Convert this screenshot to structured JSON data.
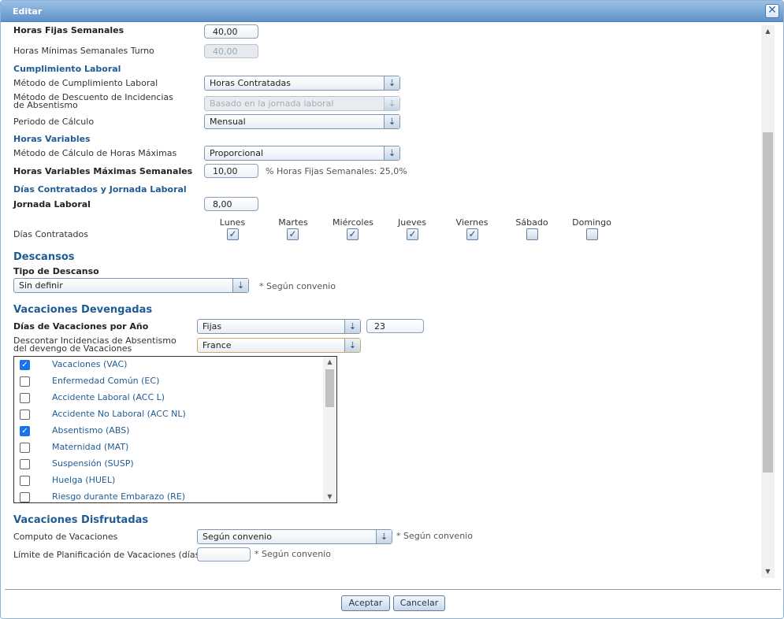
{
  "dialog": {
    "title": "Editar",
    "close_label": "✕"
  },
  "horas_fijas": {
    "label": "Horas Fijas Semanales",
    "value": "40,00"
  },
  "horas_minimas": {
    "label": "Horas Mínimas Semanales Turno",
    "value": "40,00"
  },
  "cumplimiento": {
    "section": "Cumplimiento Laboral",
    "metodo": {
      "label": "Método de Cumplimiento Laboral",
      "value": "Horas Contratadas"
    },
    "descuento": {
      "label": "Método de Descuento de Incidencias de Absentismo",
      "value": "Basado en la jornada laboral"
    },
    "periodo": {
      "label": "Periodo de Cálculo",
      "value": "Mensual"
    }
  },
  "horas_variables": {
    "section": "Horas Variables",
    "metodo": {
      "label": "Método de Cálculo de Horas Máximas",
      "value": "Proporcional"
    },
    "maximas": {
      "label": "Horas Variables Máximas Semanales",
      "value": "10,00",
      "note": "% Horas Fijas Semanales: 25,0%"
    }
  },
  "dias_contratados": {
    "section": "Días Contratados y Jornada Laboral",
    "jornada": {
      "label": "Jornada Laboral",
      "value": "8,00"
    },
    "label": "Días Contratados",
    "days": [
      {
        "name": "Lunes",
        "checked": true
      },
      {
        "name": "Martes",
        "checked": true
      },
      {
        "name": "Miércoles",
        "checked": true
      },
      {
        "name": "Jueves",
        "checked": true
      },
      {
        "name": "Viernes",
        "checked": true
      },
      {
        "name": "Sábado",
        "checked": false
      },
      {
        "name": "Domingo",
        "checked": false
      }
    ]
  },
  "descansos": {
    "section": "Descansos",
    "tipo": {
      "label": "Tipo de Descanso",
      "value": "Sin definir",
      "note": "* Según convenio"
    }
  },
  "vacaciones_devengadas": {
    "section": "Vacaciones Devengadas",
    "dias": {
      "label": "Días de Vacaciones por Año",
      "value": "Fijas",
      "number": "23"
    },
    "descontar": {
      "label": "Descontar Incidencias de Absentismo del devengo de Vacaciones",
      "value": "France"
    },
    "items": [
      {
        "label": "Vacaciones (VAC)",
        "checked": true
      },
      {
        "label": "Enfermedad Común (EC)",
        "checked": false
      },
      {
        "label": "Accidente Laboral (ACC L)",
        "checked": false
      },
      {
        "label": "Accidente No Laboral (ACC NL)",
        "checked": false
      },
      {
        "label": "Absentismo (ABS)",
        "checked": true
      },
      {
        "label": "Maternidad (MAT)",
        "checked": false
      },
      {
        "label": "Suspensión (SUSP)",
        "checked": false
      },
      {
        "label": "Huelga (HUEL)",
        "checked": false
      },
      {
        "label": "Riesgo durante Embarazo (RE)",
        "checked": false
      }
    ]
  },
  "vacaciones_disfrutadas": {
    "section": "Vacaciones Disfrutadas",
    "computo": {
      "label": "Computo de Vacaciones",
      "value": "Según convenio",
      "note": "* Según convenio"
    },
    "limite": {
      "label": "Límite de Planificación de Vacaciones (días)",
      "value": "",
      "note": "* Según convenio"
    }
  },
  "footer": {
    "accept": "Aceptar",
    "cancel": "Cancelar"
  }
}
